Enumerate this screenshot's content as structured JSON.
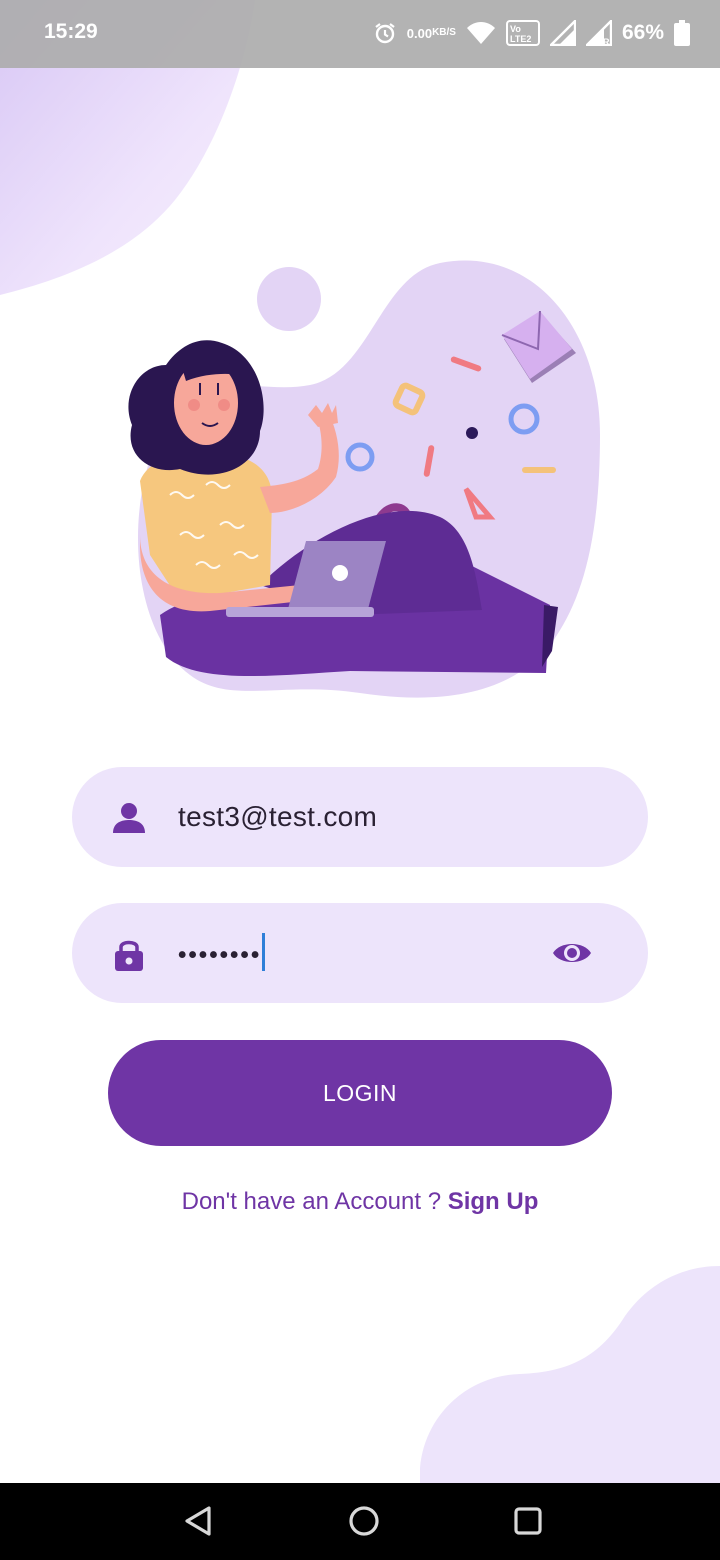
{
  "status_bar": {
    "time": "15:29",
    "net_speed_value": "0.00",
    "net_speed_unit": "KB/S",
    "volte_label": "Vo LTE2",
    "battery_percent": "66%",
    "icons": [
      "alarm-icon",
      "wifi-icon",
      "volte-icon",
      "signal-icon",
      "signal-roaming-icon",
      "battery-icon"
    ]
  },
  "login_form": {
    "email_value": "test3@test.com",
    "password_masked": "••••••••",
    "login_label": "LOGIN",
    "signup_prompt": "Don't have an Account ? ",
    "signup_link": "Sign Up"
  },
  "colors": {
    "primary": "#6f35a5",
    "field_background": "#ede4fb",
    "blob": "#e9dcf8"
  },
  "navigation": {
    "icons": [
      "back-icon",
      "home-icon",
      "recents-icon"
    ]
  }
}
